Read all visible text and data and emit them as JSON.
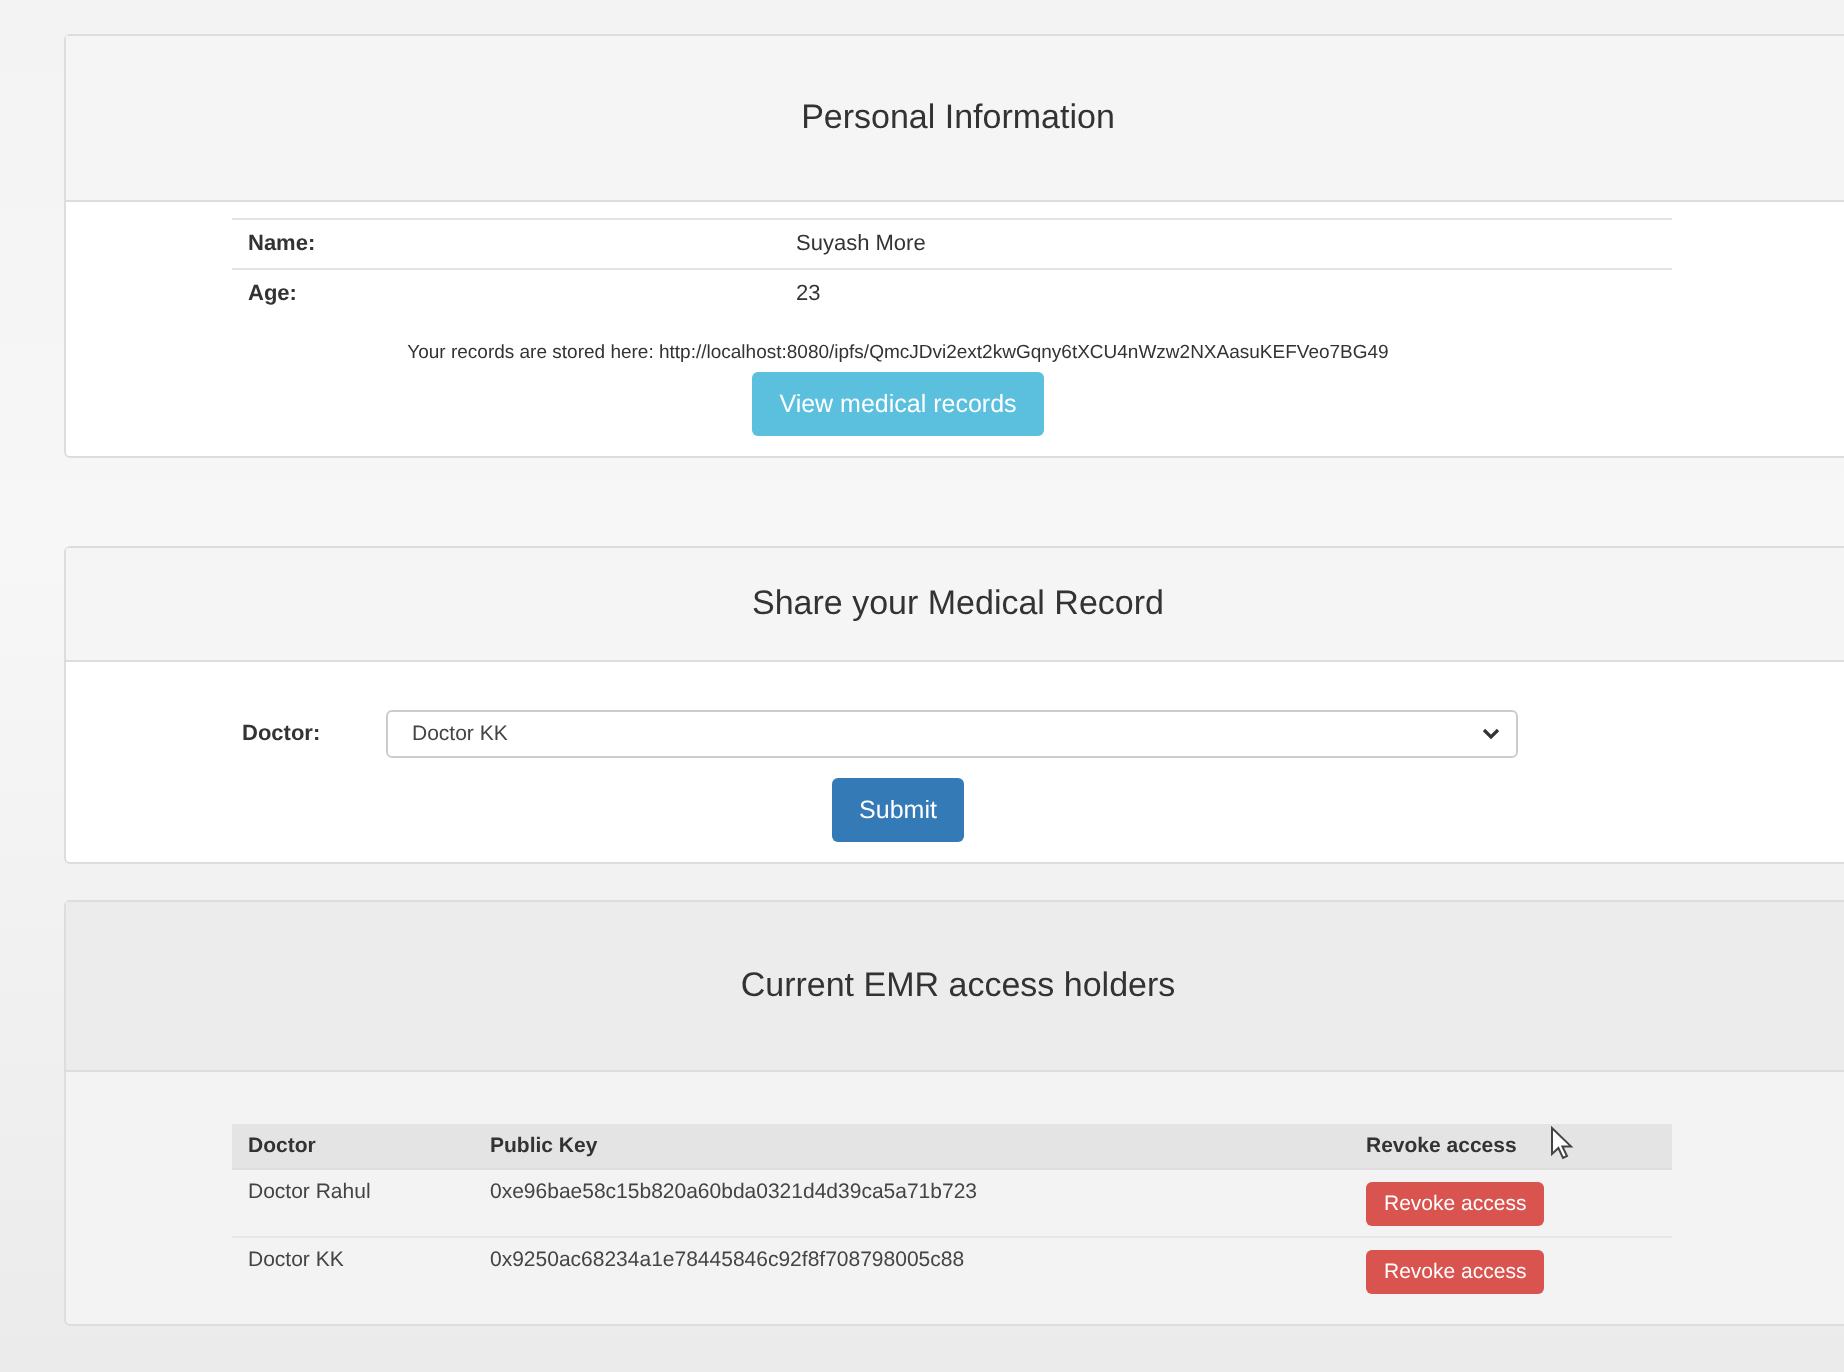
{
  "personal_information": {
    "title": "Personal Information",
    "fields": [
      {
        "label": "Name:",
        "value": "Suyash More"
      },
      {
        "label": "Age:",
        "value": "23"
      }
    ],
    "records_note": "Your records are stored here: http://localhost:8080/ipfs/QmcJDvi2ext2kwGqny6tXCU4nWzw2NXAasuKEFVeo7BG49",
    "view_button": "View medical records"
  },
  "share": {
    "title": "Share your Medical Record",
    "doctor_label": "Doctor:",
    "doctor_value": "Doctor KK",
    "submit_button": "Submit"
  },
  "access_holders": {
    "title": "Current EMR access holders",
    "columns": [
      "Doctor",
      "Public Key",
      "Revoke access"
    ],
    "rows": [
      {
        "doctor": "Doctor Rahul",
        "public_key": "0xe96bae58c15b820a60bda0321d4d39ca5a71b723",
        "action": "Revoke access"
      },
      {
        "doctor": "Doctor KK",
        "public_key": "0x9250ac68234a1e78445846c92f8f708798005c88",
        "action": "Revoke access"
      }
    ]
  }
}
